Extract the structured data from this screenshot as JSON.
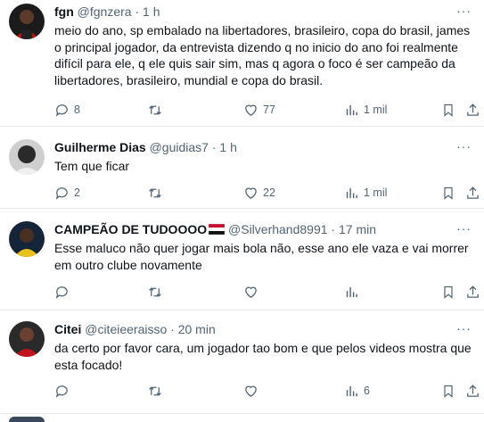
{
  "tweets": [
    {
      "name": "fgn",
      "handle": "@fgnzera",
      "sep": "·",
      "time": "1 h",
      "text_lines": [
        "meio do ano, sp embalado na libertadores, brasileiro, copa do brasil, james",
        "o principal jogador, da entrevista dizendo q no inicio do ano foi realmente",
        "difícil para ele, q ele quis sair sim, mas q agora o foco é ser campeão da",
        "libertadores, brasileiro, mundial e copa do brasil."
      ],
      "replies": "8",
      "retweets": "",
      "likes": "77",
      "views": "1 mil"
    },
    {
      "name": "Guilherme Dias",
      "handle": "@guidias7",
      "sep": "·",
      "time": "1 h",
      "text_lines": [
        "Tem que ficar"
      ],
      "replies": "2",
      "retweets": "",
      "likes": "22",
      "views": "1 mil"
    },
    {
      "name": "CAMPEÃO DE TUDOOOO",
      "handle": "@Silverhand8991",
      "sep": "·",
      "time": "17 min",
      "text_lines": [
        "Esse maluco não quer jogar mais bola não, esse ano ele vaza e vai morrer",
        "em outro clube novamente"
      ],
      "replies": "",
      "retweets": "",
      "likes": "",
      "views": ""
    },
    {
      "name": "Citei",
      "handle": "@citeieeraisso",
      "sep": "·",
      "time": "20 min",
      "text_lines": [
        "da certo por favor cara, um jogador tao bom e que pelos videos mostra que",
        "esta focado!"
      ],
      "replies": "",
      "retweets": "",
      "likes": "",
      "views": "6"
    }
  ],
  "icons": [
    "reply-icon",
    "retweet-icon",
    "like-icon",
    "views-icon",
    "bookmark-icon",
    "share-icon",
    "more-icon",
    "flag-icon"
  ],
  "colors": {
    "text": "#0f1419",
    "muted": "#536471",
    "divider": "#e7ebee"
  }
}
